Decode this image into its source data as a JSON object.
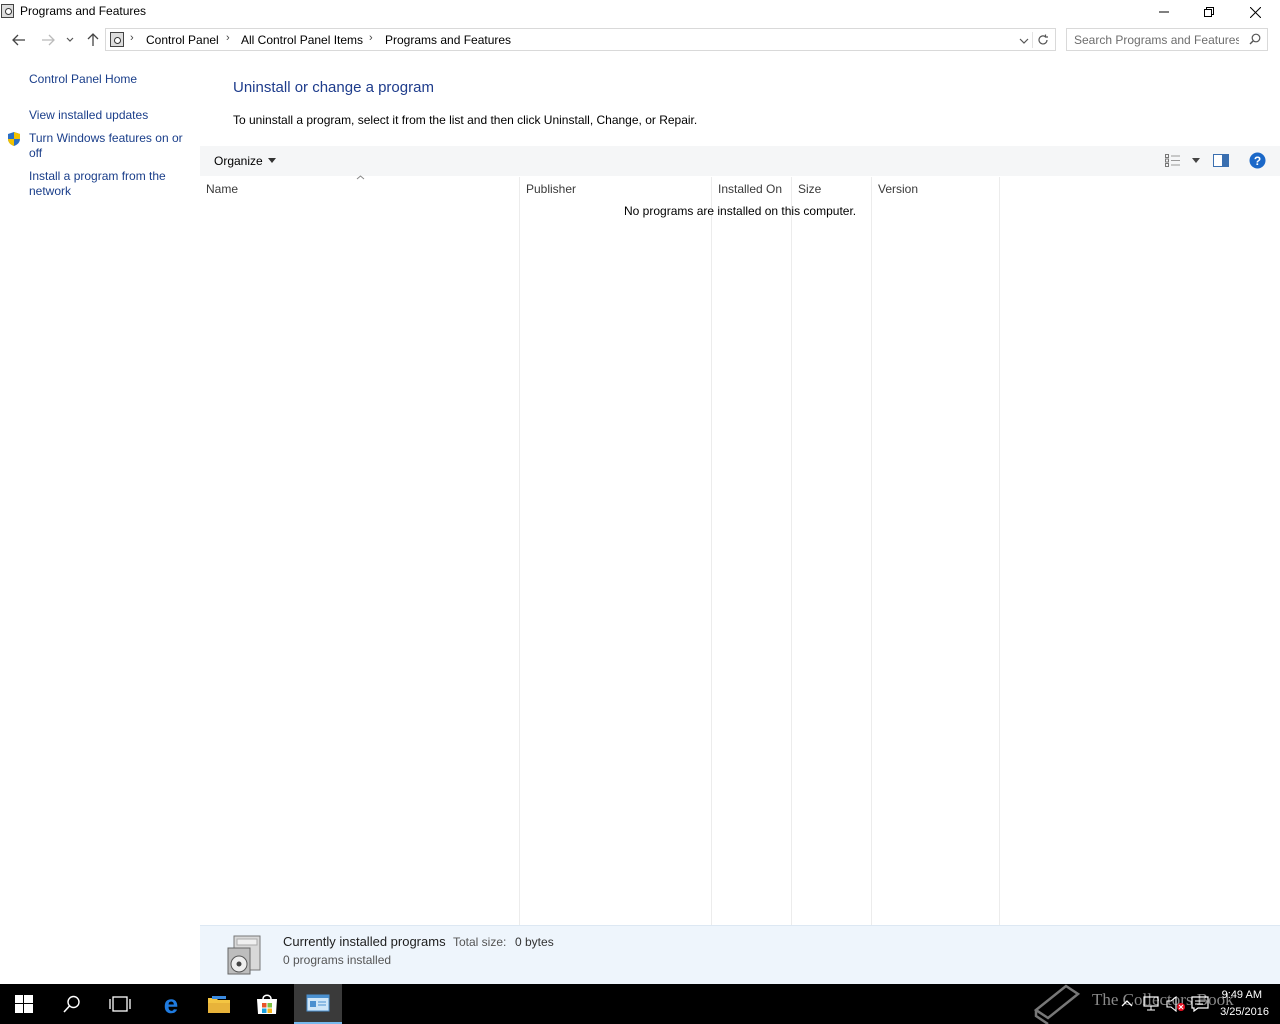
{
  "window": {
    "title": "Programs and Features"
  },
  "address": {
    "crumbs": [
      "Control Panel",
      "All Control Panel Items",
      "Programs and Features"
    ]
  },
  "search": {
    "placeholder": "Search Programs and Features"
  },
  "sidebar": {
    "home": "Control Panel Home",
    "links": [
      "View installed updates",
      "Turn Windows features on or off",
      "Install a program from the network"
    ]
  },
  "main": {
    "title": "Uninstall or change a program",
    "description": "To uninstall a program, select it from the list and then click Uninstall, Change, or Repair."
  },
  "toolbar": {
    "organize": "Organize"
  },
  "columns": [
    "Name",
    "Publisher",
    "Installed On",
    "Size",
    "Version"
  ],
  "list": {
    "empty_message": "No programs are installed on this computer."
  },
  "details": {
    "title": "Currently installed programs",
    "total_size_label": "Total size:",
    "total_size_value": "0 bytes",
    "count": "0 programs installed"
  },
  "taskbar": {
    "watermark": "The Collectors Book",
    "time": "9:49 AM",
    "date": "3/25/2016"
  },
  "colors": {
    "link": "#1a3e8a",
    "heading": "#1e3c8c",
    "details_bg": "#eef5fc",
    "taskbar_bg": "#000000",
    "active_task_underline": "#76b9ed"
  }
}
